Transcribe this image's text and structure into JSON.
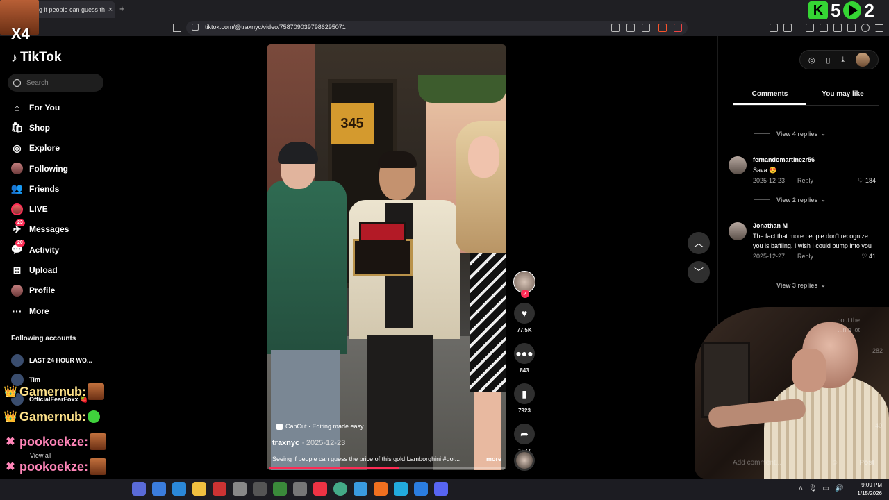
{
  "browser": {
    "tab_title": "g if people can guess th",
    "tab_close": "×",
    "new_tab": "+",
    "url": "tiktok.com/@traxnyc/video/7587090397986295071"
  },
  "stream_overlay": {
    "multiplier": "X4",
    "kick_label": "K",
    "score_a": "5",
    "score_b": "2",
    "chat": [
      {
        "user": "Gamernub:",
        "style": "gold"
      },
      {
        "user": "Gamernub:",
        "style": "gold"
      },
      {
        "user": "pookoekze:",
        "style": "pink"
      },
      {
        "user": "pookoekze:",
        "style": "pink"
      },
      {
        "user": "pookoekze:",
        "style": "pink"
      }
    ]
  },
  "tiktok": {
    "logo": "TikTok",
    "search_placeholder": "Search",
    "nav": [
      {
        "label": "For You",
        "icon": "home-icon",
        "glyph": "⌂"
      },
      {
        "label": "Shop",
        "icon": "shop-icon",
        "glyph": "🛍"
      },
      {
        "label": "Explore",
        "icon": "compass-icon",
        "glyph": "◎"
      },
      {
        "label": "Following",
        "icon": "following-avatar-icon",
        "glyph": ""
      },
      {
        "label": "Friends",
        "icon": "friends-icon",
        "glyph": "👥"
      },
      {
        "label": "LIVE",
        "icon": "live-icon",
        "glyph": ""
      },
      {
        "label": "Messages",
        "icon": "messages-icon",
        "glyph": "✈",
        "badge": "23"
      },
      {
        "label": "Activity",
        "icon": "activity-icon",
        "glyph": "💬",
        "badge": "20"
      },
      {
        "label": "Upload",
        "icon": "upload-icon",
        "glyph": "⊞"
      },
      {
        "label": "Profile",
        "icon": "profile-icon",
        "glyph": ""
      },
      {
        "label": "More",
        "icon": "more-icon",
        "glyph": "···"
      }
    ],
    "following_heading": "Following accounts",
    "following": [
      {
        "name": "LAST 24 HOUR WO..."
      },
      {
        "name": "Tim"
      },
      {
        "name": "OfficialFearFoxx 🍓"
      }
    ],
    "view_all": "View all"
  },
  "video": {
    "door_number": "345",
    "capcut": "CapCut · Editing made easy",
    "author": "traxnyc",
    "date": " · 2025-12-23",
    "caption": "Seeing if people can guess the price of this gold Lamborghini #gol...",
    "more": "more",
    "progress": 0.55,
    "likes": "77.5K",
    "comments": "843",
    "saves": "7923",
    "shares": "1577"
  },
  "panel": {
    "tabs": [
      "Comments",
      "You may like"
    ],
    "comments": [
      {
        "replies_before": "View 4 replies",
        "user": "fernandomartinezr56",
        "text": "Sava 😍",
        "date": "2025-12-23",
        "reply": "Reply",
        "likes": "184"
      },
      {
        "replies_before": "View 2 replies",
        "user": "Jonathan M",
        "text": "The fact that more people don't recognize you is baffling. I wish I could bump into you",
        "date": "2025-12-27",
        "reply": "Reply",
        "likes": "41"
      }
    ],
    "view_replies_3": "View 3 replies",
    "partial_comment": "...bout the",
    "partial_comment2": "...n a lot",
    "partial_likes": "282",
    "partial_likes2": "40",
    "add_comment": "Add comment...",
    "post": "Post"
  },
  "taskbar": {
    "time": "9:09 PM",
    "date": "1/15/2026"
  },
  "colors": {
    "accent": "#fe2c55",
    "kick_green": "#35d534",
    "chat_gold": "#ffe38a",
    "chat_pink": "#ff85b8"
  }
}
